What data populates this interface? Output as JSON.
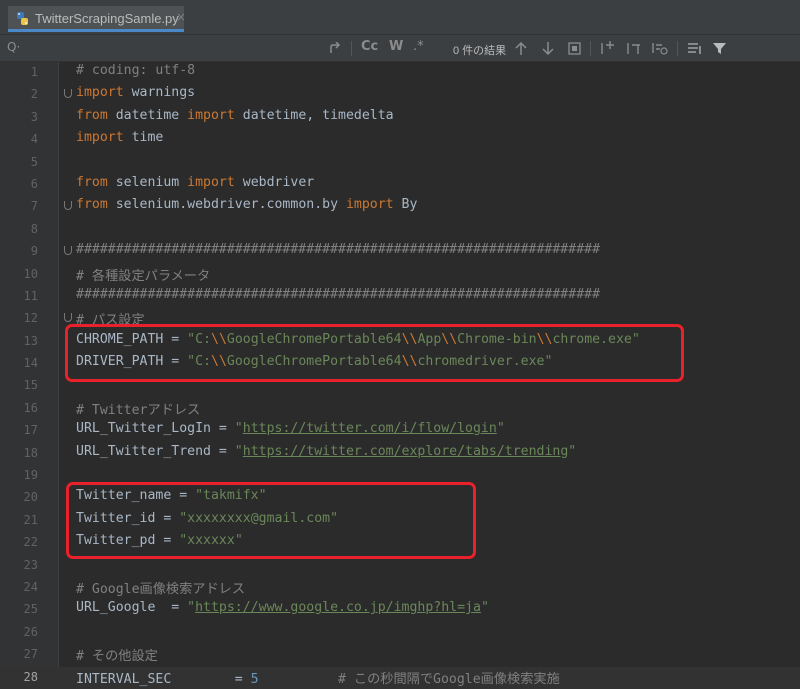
{
  "tab": {
    "title": "TwitterScrapingSamle.py",
    "close_glyph": "×"
  },
  "findbar": {
    "search_icon": "Q·",
    "results_count": "0 件の結果",
    "match_case": "Cc",
    "whole_word": "W",
    "regex": ".*",
    "icons": [
      "replace-icon",
      "arrow-up-icon",
      "arrow-down-icon",
      "select-all-icon",
      "add-caret-icon",
      "remove-caret-icon",
      "select-matches-icon",
      "filter-lines-icon",
      "funnel-icon"
    ]
  },
  "editor": {
    "current_line": "28",
    "lines": [
      {
        "n": "1",
        "t": "# coding: utf-8"
      },
      {
        "n": "2",
        "t": "import warnings"
      },
      {
        "n": "3",
        "t": "from datetime import datetime, timedelta"
      },
      {
        "n": "4",
        "t": "import time"
      },
      {
        "n": "5",
        "t": ""
      },
      {
        "n": "6",
        "t": "from selenium import webdriver"
      },
      {
        "n": "7",
        "t": "from selenium.webdriver.common.by import By"
      },
      {
        "n": "8",
        "t": ""
      },
      {
        "n": "9",
        "t": "##################################################################"
      },
      {
        "n": "10",
        "t": "# 各種設定パラメータ"
      },
      {
        "n": "11",
        "t": "##################################################################"
      },
      {
        "n": "12",
        "t": "# パス設定"
      },
      {
        "n": "13",
        "t": "CHROME_PATH = \"C:\\\\GoogleChromePortable64\\\\App\\\\Chrome-bin\\\\chrome.exe\""
      },
      {
        "n": "14",
        "t": "DRIVER_PATH = \"C:\\\\GoogleChromePortable64\\\\chromedriver.exe\""
      },
      {
        "n": "15",
        "t": ""
      },
      {
        "n": "16",
        "t": "# Twitterアドレス"
      },
      {
        "n": "17",
        "t": "URL_Twitter_LogIn = \"https://twitter.com/i/flow/login\""
      },
      {
        "n": "18",
        "t": "URL_Twitter_Trend = \"https://twitter.com/explore/tabs/trending\""
      },
      {
        "n": "19",
        "t": ""
      },
      {
        "n": "20",
        "t": "Twitter_name = \"takmifx\""
      },
      {
        "n": "21",
        "t": "Twitter_id = \"xxxxxxxx@gmail.com\""
      },
      {
        "n": "22",
        "t": "Twitter_pd = \"xxxxxx\""
      },
      {
        "n": "23",
        "t": ""
      },
      {
        "n": "24",
        "t": "# Google画像検索アドレス"
      },
      {
        "n": "25",
        "t": "URL_Google  = \"https://www.google.co.jp/imghp?hl=ja\""
      },
      {
        "n": "26",
        "t": ""
      },
      {
        "n": "27",
        "t": "# その他設定"
      },
      {
        "n": "28",
        "t": "INTERVAL_SEC        = 5          # この秒間隔でGoogle画像検索実施"
      }
    ]
  },
  "colors": {
    "background": "#2b2b2b",
    "keyword": "#cc7832",
    "string": "#6a8759",
    "comment": "#808080",
    "number": "#6897bb",
    "highlight_box": "#e8212a"
  }
}
